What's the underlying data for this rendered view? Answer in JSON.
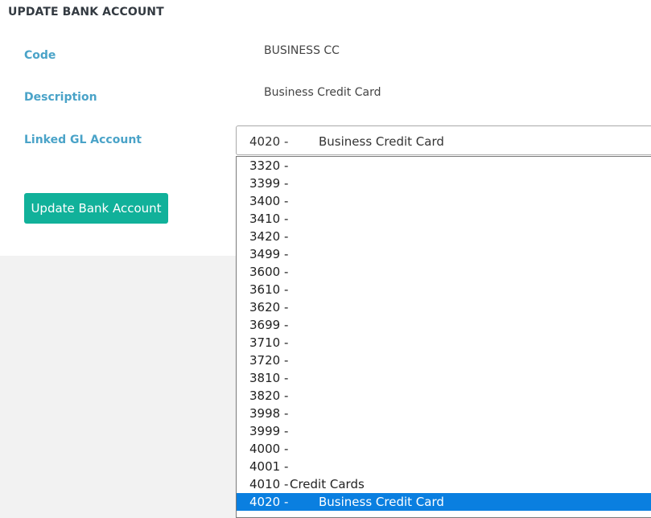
{
  "page": {
    "title": "UPDATE BANK ACCOUNT"
  },
  "form": {
    "code_label": "Code",
    "code_value": "BUSINESS CC",
    "description_label": "Description",
    "description_value": "Business Credit Card",
    "gl_label": "Linked GL Account",
    "gl_selected_code": "4020 -",
    "gl_selected_name": "Business Credit Card",
    "submit_label": "Update Bank Account"
  },
  "dropdown": {
    "options": [
      {
        "code": "3320 -",
        "name": ""
      },
      {
        "code": "3399 -",
        "name": ""
      },
      {
        "code": "3400 -",
        "name": ""
      },
      {
        "code": "3410 -",
        "name": ""
      },
      {
        "code": "3420 -",
        "name": ""
      },
      {
        "code": "3499 -",
        "name": ""
      },
      {
        "code": "3600 -",
        "name": ""
      },
      {
        "code": "3610 -",
        "name": ""
      },
      {
        "code": "3620 -",
        "name": ""
      },
      {
        "code": "3699 -",
        "name": ""
      },
      {
        "code": "3710 -",
        "name": ""
      },
      {
        "code": "3720 -",
        "name": ""
      },
      {
        "code": "3810 -",
        "name": ""
      },
      {
        "code": "3820 -",
        "name": ""
      },
      {
        "code": "3998 -",
        "name": ""
      },
      {
        "code": "3999 -",
        "name": ""
      },
      {
        "code": "4000 -",
        "name": ""
      },
      {
        "code": "4001 -",
        "name": ""
      },
      {
        "code": "4010 -",
        "name": "Credit Cards"
      },
      {
        "code": "4020 -",
        "name": "Business Credit Card"
      }
    ]
  },
  "colors": {
    "label": "#4aa3c8",
    "button": "#11b19a",
    "selected_option": "#0a7fe0"
  }
}
